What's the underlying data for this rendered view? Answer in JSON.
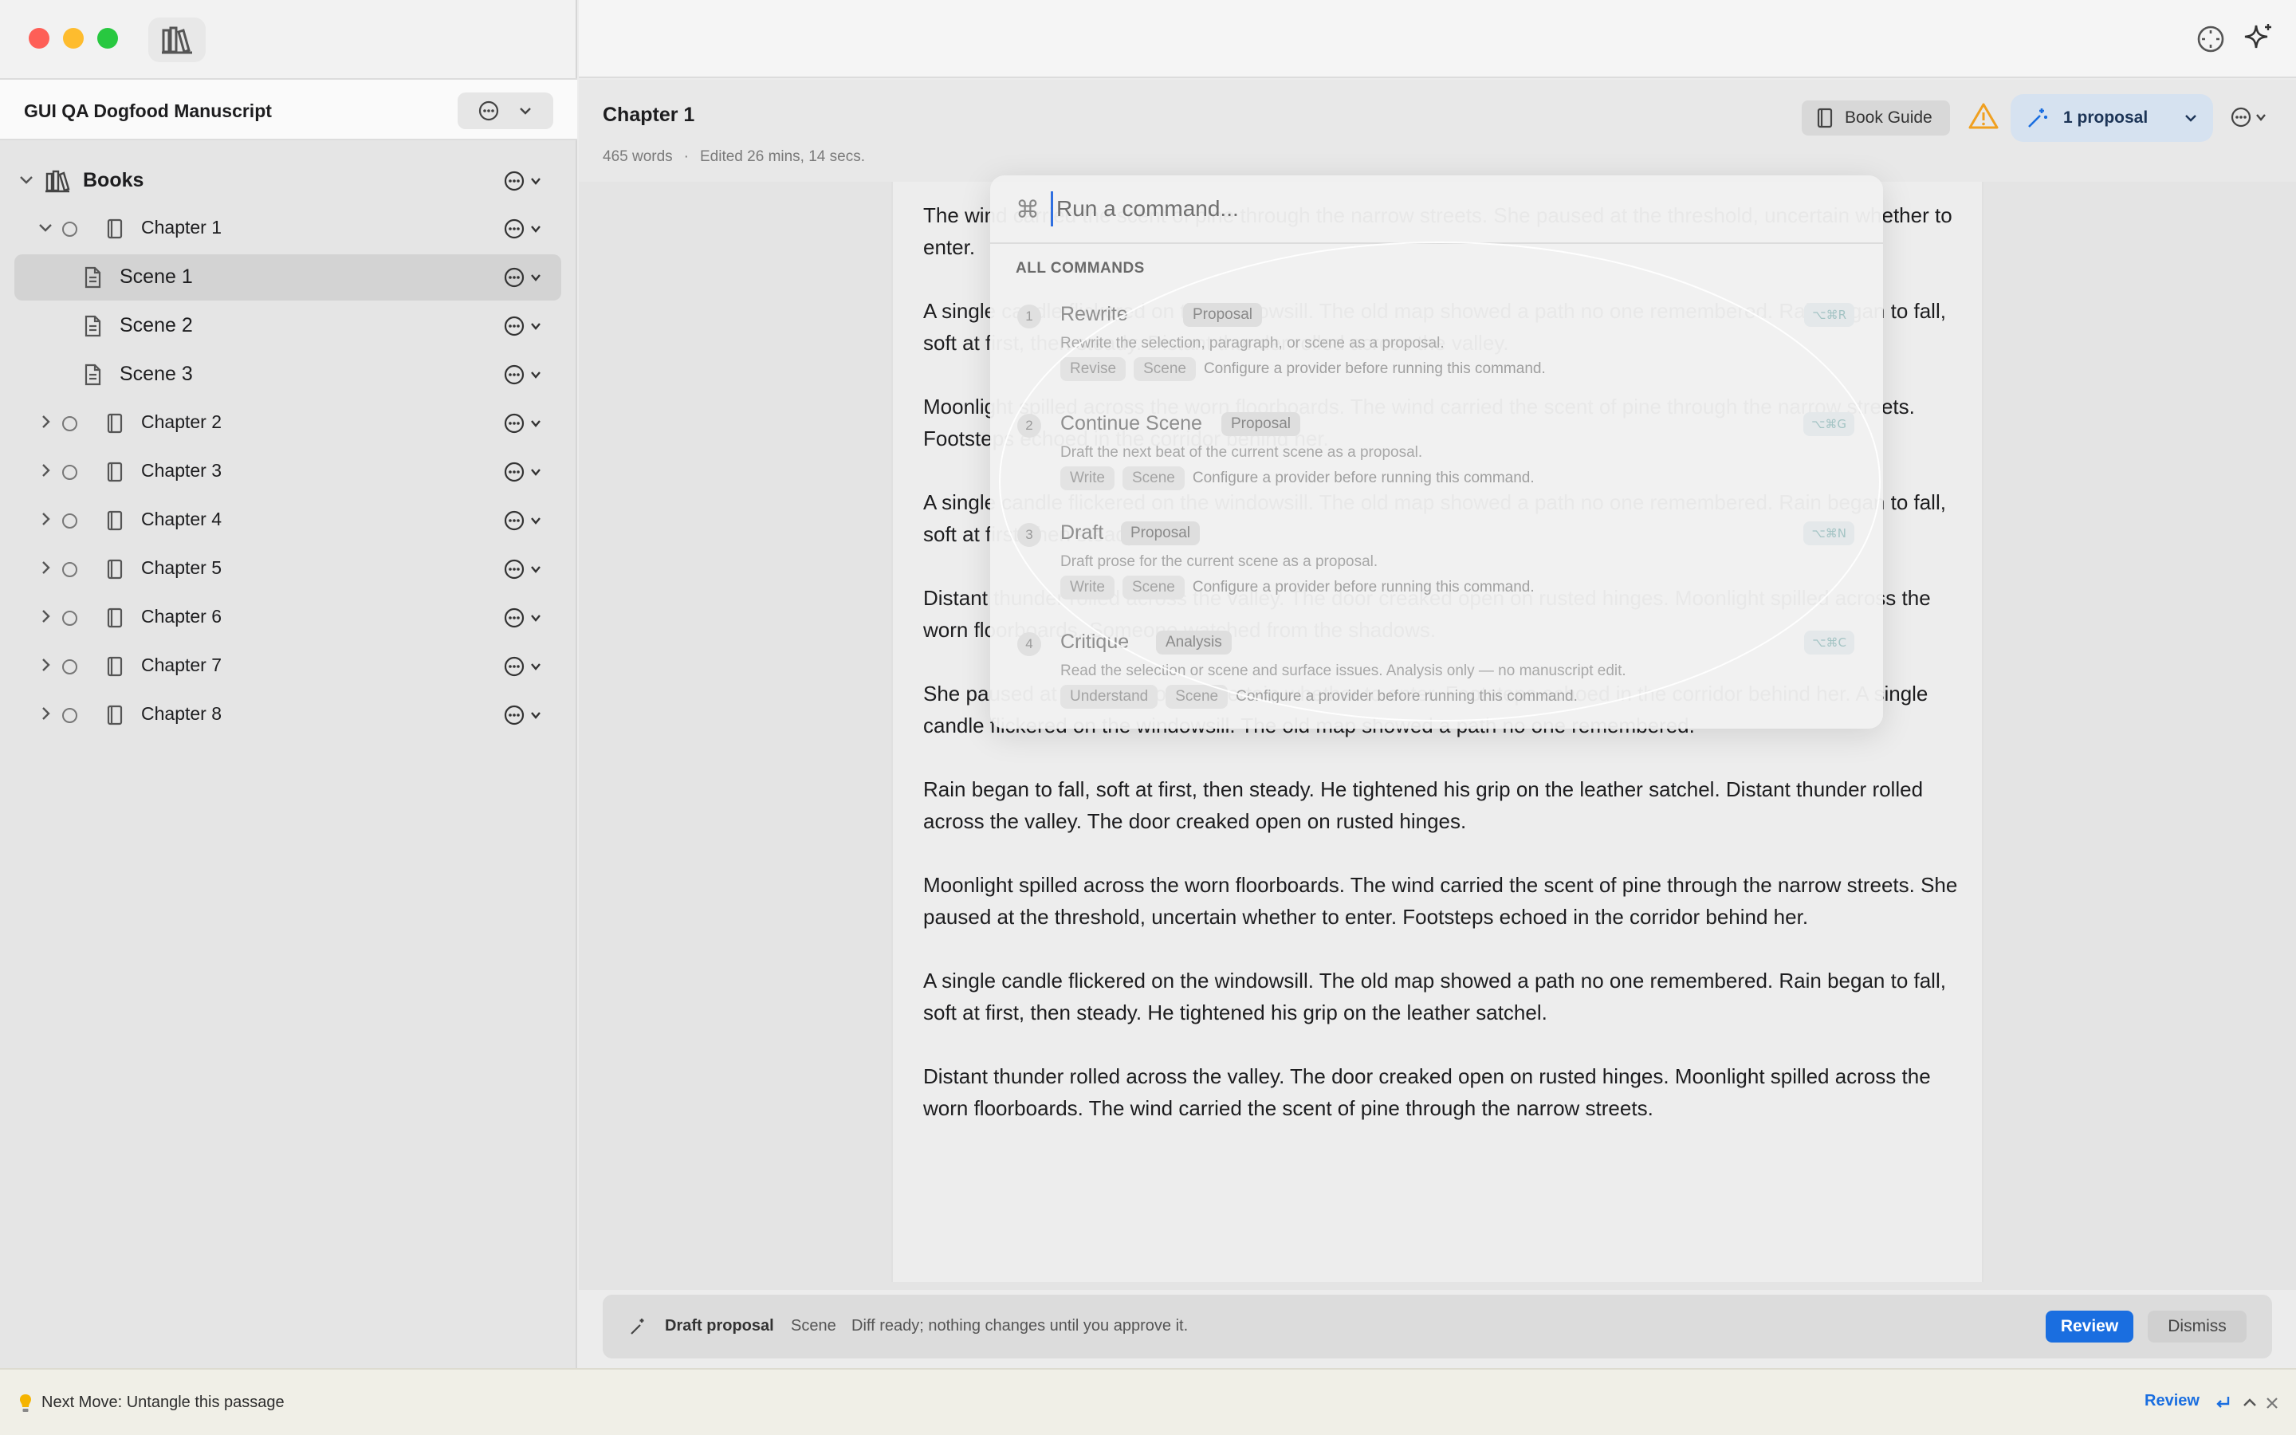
{
  "sidebar": {
    "manuscript_title": "GUI QA Dogfood Manuscript",
    "root_label": "Books",
    "items": [
      {
        "label": "Chapter 1",
        "type": "chapter",
        "expanded": true
      },
      {
        "label": "Scene 1",
        "type": "scene",
        "selected": true
      },
      {
        "label": "Scene 2",
        "type": "scene"
      },
      {
        "label": "Scene 3",
        "type": "scene"
      },
      {
        "label": "Chapter 2",
        "type": "chapter"
      },
      {
        "label": "Chapter 3",
        "type": "chapter"
      },
      {
        "label": "Chapter 4",
        "type": "chapter"
      },
      {
        "label": "Chapter 5",
        "type": "chapter"
      },
      {
        "label": "Chapter 6",
        "type": "chapter"
      },
      {
        "label": "Chapter 7",
        "type": "chapter"
      },
      {
        "label": "Chapter 8",
        "type": "chapter"
      }
    ]
  },
  "header": {
    "title": "Chapter 1",
    "word_count": "465 words",
    "edited": "Edited 26 mins, 14 secs.",
    "book_guide": "Book Guide",
    "proposal_label": "1 proposal"
  },
  "document": {
    "paragraphs": [
      "The wind carried the scent of pine through the narrow streets. She paused at the threshold, uncertain whether to enter.",
      "A single candle flickered on the windowsill. The old map showed a path no one remembered. Rain began to fall, soft at first, then steady. Distant thunder rolled across the valley.",
      "Moonlight spilled across the worn floorboards. The wind carried the scent of pine through the narrow streets. Footsteps echoed in the corridor behind her.",
      "A single candle flickered on the windowsill. The old map showed a path no one remembered. Rain began to fall, soft at first, then steady.",
      "Distant thunder rolled across the valley. The door creaked open on rusted hinges. Moonlight spilled across the worn floorboards. Someone watched from the shadows.",
      "She paused at the threshold, uncertain whether to enter. Footsteps echoed in the corridor behind her. A single candle flickered on the windowsill. The old map showed a path no one remembered.",
      "Rain began to fall, soft at first, then steady. He tightened his grip on the leather satchel. Distant thunder rolled across the valley. The door creaked open on rusted hinges.",
      "Moonlight spilled across the worn floorboards. The wind carried the scent of pine through the narrow streets. She paused at the threshold, uncertain whether to enter. Footsteps echoed in the corridor behind her.",
      "A single candle flickered on the windowsill. The old map showed a path no one remembered. Rain began to fall, soft at first, then steady. He tightened his grip on the leather satchel.",
      "Distant thunder rolled across the valley. The door creaked open on rusted hinges. Moonlight spilled across the worn floorboards. The wind carried the scent of pine through the narrow streets."
    ]
  },
  "palette": {
    "placeholder": "Run a command...",
    "cmd_symbol": "⌘",
    "section": "ALL COMMANDS",
    "commands": [
      {
        "num": "1",
        "name": "Rewrite",
        "kind": "Proposal",
        "description": "Rewrite the selection, paragraph, or scene as a proposal.",
        "tags": [
          "Revise",
          "Scene"
        ],
        "note": "Configure a provider before running this command.",
        "shortcut": "⌥⌘R"
      },
      {
        "num": "2",
        "name": "Continue Scene",
        "kind": "Proposal",
        "description": "Draft the next beat of the current scene as a proposal.",
        "tags": [
          "Write",
          "Scene"
        ],
        "note": "Configure a provider before running this command.",
        "shortcut": "⌥⌘G"
      },
      {
        "num": "3",
        "name": "Draft",
        "kind": "Proposal",
        "description": "Draft prose for the current scene as a proposal.",
        "tags": [
          "Write",
          "Scene"
        ],
        "note": "Configure a provider before running this command.",
        "shortcut": "⌥⌘N"
      },
      {
        "num": "4",
        "name": "Critique",
        "kind": "Analysis",
        "description": "Read the selection or scene and surface issues. Analysis only — no manuscript edit.",
        "tags": [
          "Understand",
          "Scene"
        ],
        "note": "Configure a provider before running this command.",
        "shortcut": "⌥⌘C"
      }
    ]
  },
  "proposal_bar": {
    "title": "Draft proposal",
    "scope": "Scene",
    "message": "Diff ready; nothing changes until you approve it.",
    "review": "Review",
    "dismiss": "Dismiss"
  },
  "status_bar": {
    "text": "Next Move: Untangle this passage",
    "review": "Review"
  },
  "colors": {
    "accent": "#1a6ee0",
    "warning": "#f0a020",
    "sidebar_bg": "#e5e5e5",
    "selected_row": "#d3d3d3"
  }
}
